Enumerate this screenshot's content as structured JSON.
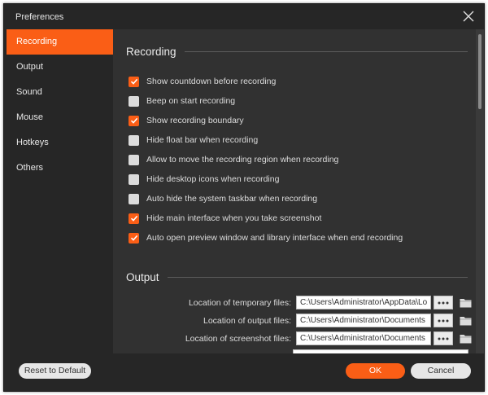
{
  "window": {
    "title": "Preferences"
  },
  "sidebar": {
    "items": [
      {
        "label": "Recording",
        "active": true
      },
      {
        "label": "Output",
        "active": false
      },
      {
        "label": "Sound",
        "active": false
      },
      {
        "label": "Mouse",
        "active": false
      },
      {
        "label": "Hotkeys",
        "active": false
      },
      {
        "label": "Others",
        "active": false
      }
    ]
  },
  "recording": {
    "title": "Recording",
    "options": [
      {
        "label": "Show countdown before recording",
        "checked": true
      },
      {
        "label": "Beep on start recording",
        "checked": false
      },
      {
        "label": "Show recording boundary",
        "checked": true
      },
      {
        "label": "Hide float bar when recording",
        "checked": false
      },
      {
        "label": "Allow to move the recording region when recording",
        "checked": false
      },
      {
        "label": "Hide desktop icons when recording",
        "checked": false
      },
      {
        "label": "Auto hide the system taskbar when recording",
        "checked": false
      },
      {
        "label": "Hide main interface when you take screenshot",
        "checked": true
      },
      {
        "label": "Auto open preview window and library interface when end recording",
        "checked": true
      }
    ]
  },
  "output": {
    "title": "Output",
    "rows": [
      {
        "label": "Location of temporary files:",
        "value": "C:\\Users\\Administrator\\AppData\\Lo"
      },
      {
        "label": "Location of output files:",
        "value": "C:\\Users\\Administrator\\Documents"
      },
      {
        "label": "Location of screenshot files:",
        "value": "C:\\Users\\Administrator\\Documents"
      }
    ]
  },
  "footer": {
    "reset_label": "Reset to Default",
    "ok_label": "OK",
    "cancel_label": "Cancel"
  },
  "colors": {
    "accent": "#fa5e16",
    "background": "#262626",
    "panel": "#313131"
  },
  "icons": {
    "close": "close-icon",
    "checkmark": "checkmark-icon",
    "more": "more-dots-icon",
    "folder": "folder-icon"
  }
}
